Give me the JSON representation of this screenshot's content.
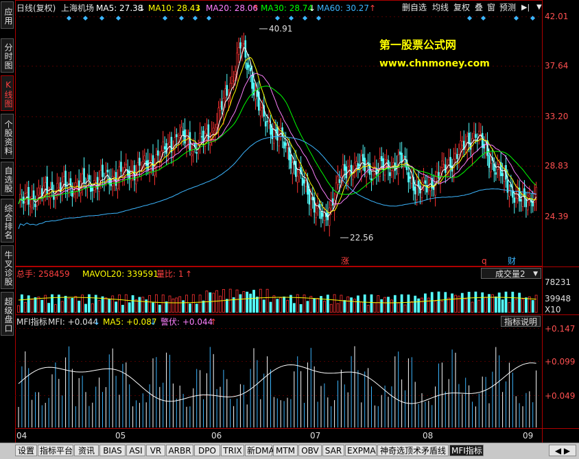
{
  "sidebar": {
    "items": [
      {
        "label": "应用",
        "active": false
      },
      {
        "label": "分时图",
        "active": false
      },
      {
        "label": "K线图",
        "active": true
      },
      {
        "label": "个股资料",
        "active": false
      },
      {
        "label": "自选股",
        "active": false
      },
      {
        "label": "综合排名",
        "active": false
      },
      {
        "label": "牛叉诊股",
        "active": false
      },
      {
        "label": "超级盘口",
        "active": false
      }
    ]
  },
  "header": {
    "period": "日线(复权)",
    "stock": "上海机场",
    "ma5": "MA5: 27.38",
    "ma10": "MA10: 28.43",
    "ma20": "MA20: 28.06",
    "ma30": "MA30: 28.74",
    "ma60": "MA60: 30.27",
    "buttons": [
      "删自选",
      "均线",
      "复权",
      "叠",
      "窗",
      "预测"
    ]
  },
  "watermark": {
    "line1": "第一股票公式网",
    "line2": "www.chnmoney.com"
  },
  "price_axis": {
    "ticks": [
      "42.01",
      "37.64",
      "33.20",
      "28.83",
      "24.39"
    ],
    "high_label": "40.91",
    "low_label": "22.56"
  },
  "markers": {
    "zhang": "涨",
    "q": "q",
    "cai": "财"
  },
  "volume": {
    "total": "总手: 258459",
    "mavol": "MAVOL20: 339591",
    "ratio": "量比: 1",
    "dropdown": "成交量2",
    "ticks": [
      "78231",
      "39948",
      "X10"
    ]
  },
  "mfi": {
    "name": "MFI指标",
    "mfi": "MFI: +0.044",
    "ma5": "MA5: +0.087",
    "signal": "警伏: +0.044",
    "help_button": "指标说明",
    "ticks": [
      "+0.147",
      "+0.099",
      "+0.049"
    ]
  },
  "date_axis": [
    "04",
    "05",
    "06",
    "07",
    "08",
    "09"
  ],
  "tabs": [
    "设置",
    "指标平台",
    "资讯",
    "BIAS",
    "ASI",
    "VR",
    "ARBR",
    "DPO",
    "TRIX",
    "新DMA",
    "MTM",
    "OBV",
    "SAR",
    "EXPMA",
    "神奇选顶术矛盾线",
    "MFI指标"
  ],
  "active_tab": "MFI指标",
  "colors": {
    "up": "#ff3232",
    "down": "#54ffff",
    "ma5": "#ffffff",
    "ma10": "#ffff00",
    "ma20": "#ff80ff",
    "ma30": "#00ff00",
    "ma60": "#3cb6ff",
    "axis": "#b00000",
    "watermark": "#ffff00"
  }
}
